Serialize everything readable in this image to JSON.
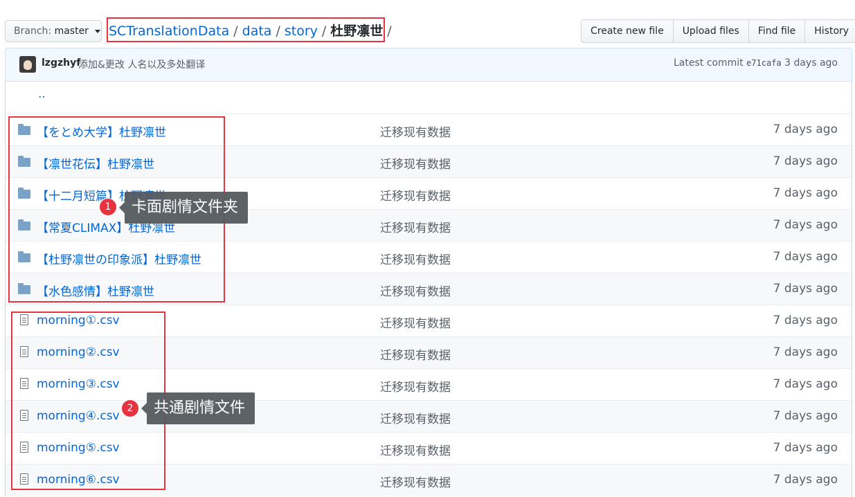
{
  "toolbar": {
    "branch_label": "Branch:",
    "branch_value": "master",
    "buttons": [
      "Create new file",
      "Upload files",
      "Find file",
      "History"
    ]
  },
  "breadcrumb": {
    "repo": "SCTranslationData",
    "parts": [
      "data",
      "story"
    ],
    "current": "杜野凛世",
    "trailing_sep": "/"
  },
  "commit": {
    "author": "lzgzhyf",
    "message": "添加&更改 人名以及多处翻译",
    "latest_label": "Latest commit",
    "sha": "e71cafa",
    "age": "3 days ago"
  },
  "parent_dir": "..",
  "files": [
    {
      "type": "folder",
      "name": "【をとめ大学】杜野凛世",
      "message": "迁移现有数据",
      "age": "7 days ago"
    },
    {
      "type": "folder",
      "name": "【凛世花伝】杜野凛世",
      "message": "迁移现有数据",
      "age": "7 days ago"
    },
    {
      "type": "folder",
      "name": "【十二月短篇】杜野凛世",
      "message": "迁移现有数据",
      "age": "7 days ago"
    },
    {
      "type": "folder",
      "name": "【常夏CLIMAX】杜野凛世",
      "message": "迁移现有数据",
      "age": "7 days ago"
    },
    {
      "type": "folder",
      "name": "【杜野凛世の印象派】杜野凛世",
      "message": "迁移现有数据",
      "age": "7 days ago"
    },
    {
      "type": "folder",
      "name": "【水色感情】杜野凛世",
      "message": "迁移现有数据",
      "age": "7 days ago"
    },
    {
      "type": "file",
      "name": "morning①.csv",
      "message": "迁移现有数据",
      "age": "7 days ago"
    },
    {
      "type": "file",
      "name": "morning②.csv",
      "message": "迁移现有数据",
      "age": "7 days ago"
    },
    {
      "type": "file",
      "name": "morning③.csv",
      "message": "迁移现有数据",
      "age": "7 days ago"
    },
    {
      "type": "file",
      "name": "morning④.csv",
      "message": "迁移现有数据",
      "age": "7 days ago"
    },
    {
      "type": "file",
      "name": "morning⑤.csv",
      "message": "迁移现有数据",
      "age": "7 days ago"
    },
    {
      "type": "file",
      "name": "morning⑥.csv",
      "message": "迁移现有数据",
      "age": "7 days ago"
    }
  ],
  "annotations": [
    {
      "number": "1",
      "text": "卡面剧情文件夹"
    },
    {
      "number": "2",
      "text": "共通剧情文件"
    }
  ],
  "colors": {
    "link": "#0366d6",
    "highlight": "#e5343f",
    "callout_bg": "#555a5f"
  }
}
